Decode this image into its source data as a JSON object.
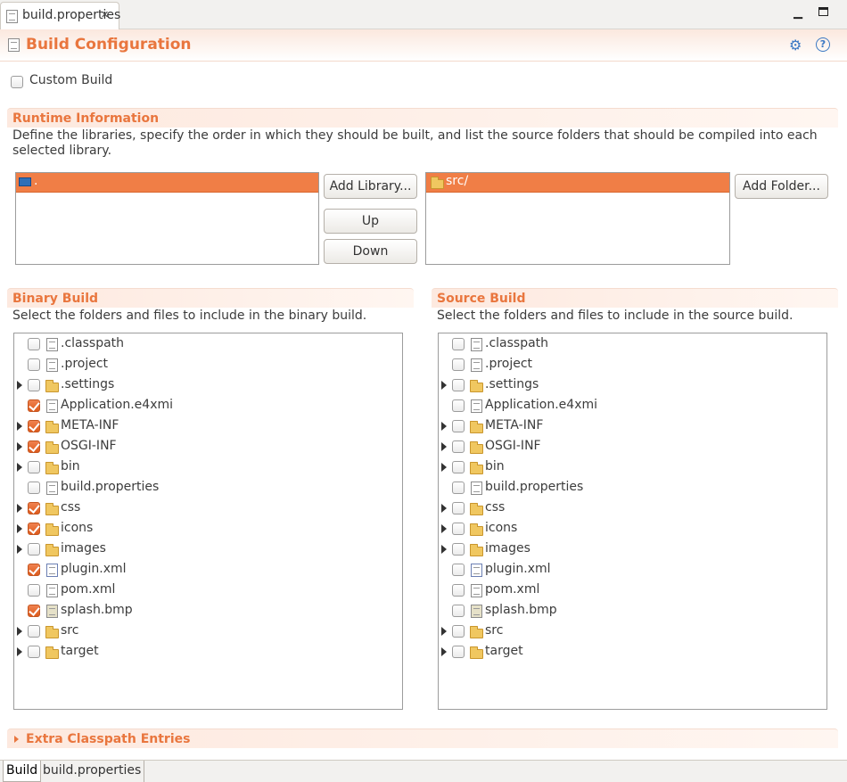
{
  "editor_tab": {
    "title": "build.properties",
    "close_icon": "close-icon"
  },
  "window_controls": {
    "minimize": "minimize-icon",
    "maximize": "maximize-icon"
  },
  "form": {
    "title": "Build Configuration",
    "toolbar_icons": [
      "run-icon",
      "help-icon"
    ],
    "help_glyph": "?"
  },
  "custom_build": {
    "label": "Custom Build",
    "checked": false
  },
  "runtime": {
    "title": "Runtime Information",
    "description": "Define the libraries, specify the order in which they should be built, and list the source folders that should be compiled into each selected library.",
    "libraries": [
      {
        "label": ".",
        "icon": "library-icon"
      }
    ],
    "add_library_label": "Add Library...",
    "up_label": "Up",
    "down_label": "Down",
    "folders": [
      {
        "label": "src/",
        "icon": "folder-icon"
      }
    ],
    "add_folder_label": "Add Folder..."
  },
  "binary_build": {
    "title": "Binary Build",
    "description": "Select the folders and files to include in the binary build.",
    "items": [
      {
        "label": ".classpath",
        "type": "file",
        "expandable": false,
        "checked": false
      },
      {
        "label": ".project",
        "type": "file",
        "expandable": false,
        "checked": false
      },
      {
        "label": ".settings",
        "type": "folder",
        "expandable": true,
        "checked": false
      },
      {
        "label": "Application.e4xmi",
        "type": "file",
        "expandable": false,
        "checked": true
      },
      {
        "label": "META-INF",
        "type": "folder",
        "expandable": true,
        "checked": true
      },
      {
        "label": "OSGI-INF",
        "type": "folder",
        "expandable": true,
        "checked": true
      },
      {
        "label": "bin",
        "type": "folder",
        "expandable": true,
        "checked": false
      },
      {
        "label": "build.properties",
        "type": "properties",
        "expandable": false,
        "checked": false
      },
      {
        "label": "css",
        "type": "folder",
        "expandable": true,
        "checked": true
      },
      {
        "label": "icons",
        "type": "folder",
        "expandable": true,
        "checked": true
      },
      {
        "label": "images",
        "type": "folder",
        "expandable": true,
        "checked": false
      },
      {
        "label": "plugin.xml",
        "type": "plugin",
        "expandable": false,
        "checked": true
      },
      {
        "label": "pom.xml",
        "type": "file",
        "expandable": false,
        "checked": false
      },
      {
        "label": "splash.bmp",
        "type": "image",
        "expandable": false,
        "checked": true
      },
      {
        "label": "src",
        "type": "folder",
        "expandable": true,
        "checked": false
      },
      {
        "label": "target",
        "type": "folder",
        "expandable": true,
        "checked": false
      }
    ]
  },
  "source_build": {
    "title": "Source Build",
    "description": "Select the folders and files to include in the source build.",
    "items": [
      {
        "label": ".classpath",
        "type": "file",
        "expandable": false,
        "checked": false
      },
      {
        "label": ".project",
        "type": "file",
        "expandable": false,
        "checked": false
      },
      {
        "label": ".settings",
        "type": "folder",
        "expandable": true,
        "checked": false
      },
      {
        "label": "Application.e4xmi",
        "type": "file",
        "expandable": false,
        "checked": false
      },
      {
        "label": "META-INF",
        "type": "folder",
        "expandable": true,
        "checked": false
      },
      {
        "label": "OSGI-INF",
        "type": "folder",
        "expandable": true,
        "checked": false
      },
      {
        "label": "bin",
        "type": "folder",
        "expandable": true,
        "checked": false
      },
      {
        "label": "build.properties",
        "type": "properties",
        "expandable": false,
        "checked": false
      },
      {
        "label": "css",
        "type": "folder",
        "expandable": true,
        "checked": false
      },
      {
        "label": "icons",
        "type": "folder",
        "expandable": true,
        "checked": false
      },
      {
        "label": "images",
        "type": "folder",
        "expandable": true,
        "checked": false
      },
      {
        "label": "plugin.xml",
        "type": "plugin",
        "expandable": false,
        "checked": false
      },
      {
        "label": "pom.xml",
        "type": "file",
        "expandable": false,
        "checked": false
      },
      {
        "label": "splash.bmp",
        "type": "image",
        "expandable": false,
        "checked": false
      },
      {
        "label": "src",
        "type": "folder",
        "expandable": true,
        "checked": false
      },
      {
        "label": "target",
        "type": "folder",
        "expandable": true,
        "checked": false
      }
    ]
  },
  "extra_classpath": {
    "title": "Extra Classpath Entries",
    "expanded": false
  },
  "bottom_tabs": [
    {
      "label": "Build",
      "active": true
    },
    {
      "label": "build.properties",
      "active": false
    }
  ],
  "colors": {
    "accent": "#e9763e",
    "selection": "#f07e46",
    "folder": "#f0c760"
  }
}
